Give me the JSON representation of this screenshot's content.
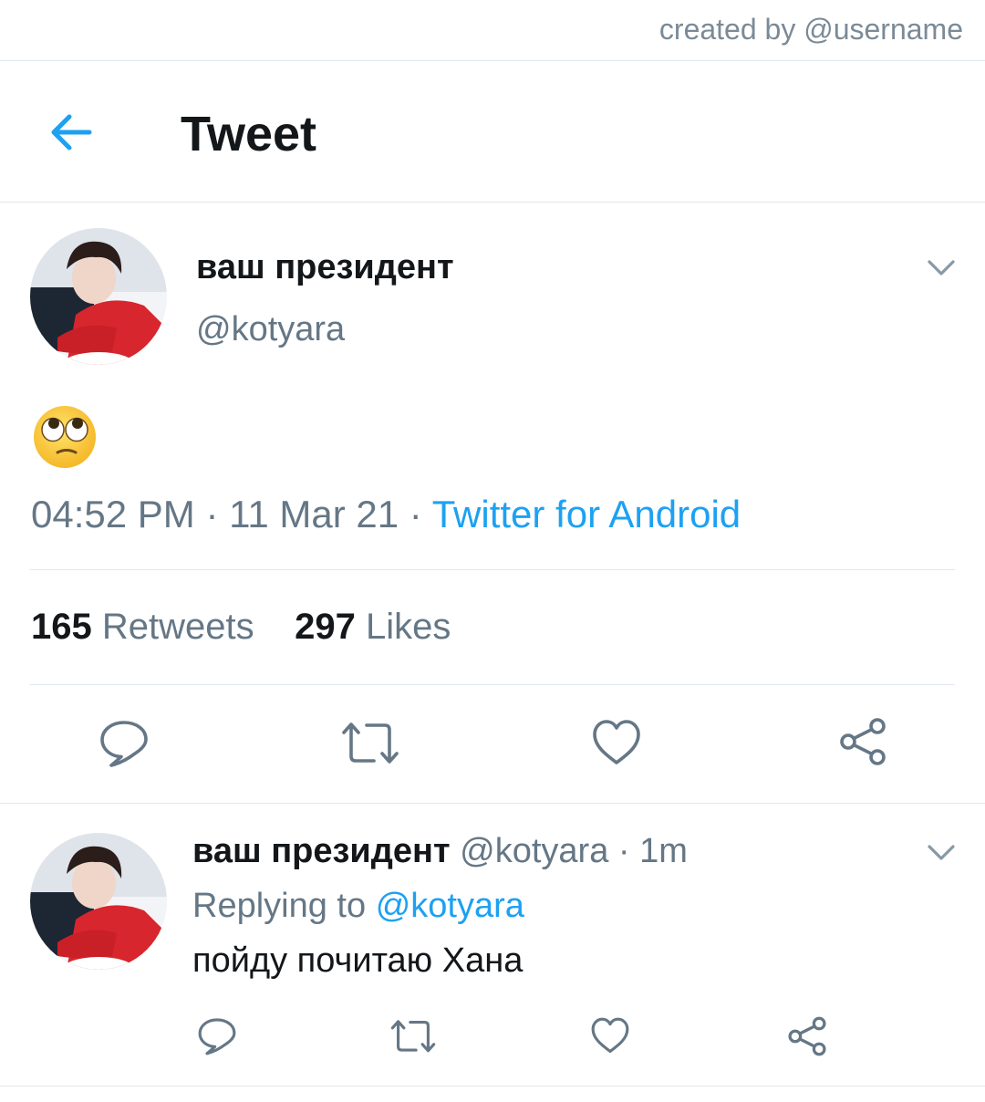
{
  "credit": "created by @username",
  "header": {
    "title": "Tweet"
  },
  "tweet": {
    "display_name": "ваш президент",
    "handle": "@kotyara",
    "content_emoji": "face-with-rolling-eyes",
    "time": "04:52 PM",
    "date": "11 Mar 21",
    "source": "Twitter for Android",
    "sep1": " · ",
    "sep2": " · ",
    "retweet_count": "165",
    "retweet_label": "Retweets",
    "like_count": "297",
    "like_label": "Likes"
  },
  "reply": {
    "display_name": "ваш президент",
    "handle": "@kotyara",
    "time_sep": " · ",
    "time": "1m",
    "replying_to_label": "Replying to",
    "replying_to_handle": "@kotyara",
    "text": "пойду почитаю Хана"
  },
  "icons": [
    "back-arrow-icon",
    "chevron-down-icon",
    "reply-icon",
    "retweet-icon",
    "like-icon",
    "share-icon"
  ],
  "colors": {
    "accent": "#1da1f2",
    "secondary_text": "#657786",
    "primary_text": "#14171a",
    "divider": "#e1e8ed"
  }
}
